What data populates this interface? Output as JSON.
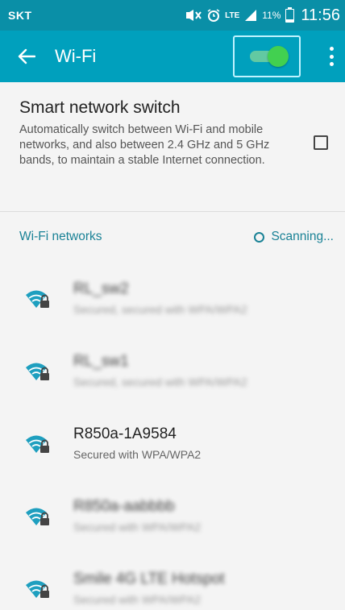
{
  "status_bar": {
    "carrier": "SKT",
    "network_type": "LTE",
    "battery_percent": "11%",
    "time": "11:56"
  },
  "app_bar": {
    "title": "Wi-Fi",
    "wifi_toggle_on": true
  },
  "smart_network_switch": {
    "title": "Smart network switch",
    "description": "Automatically switch between Wi-Fi and mobile networks, and also between 2.4 GHz and 5 GHz bands, to maintain a stable Internet connection.",
    "checked": false
  },
  "networks_section": {
    "label": "Wi-Fi networks",
    "status": "Scanning..."
  },
  "networks": [
    {
      "name": "RL_sw2",
      "security": "Secured, secured with WPA/WPA2",
      "blurred": true
    },
    {
      "name": "RL_sw1",
      "security": "Secured, secured with WPA/WPA2",
      "blurred": true
    },
    {
      "name": "R850a-1A9584",
      "security": "Secured with WPA/WPA2",
      "blurred": false
    },
    {
      "name": "R850a-aabbbb",
      "security": "Secured with WPA/WPA2",
      "blurred": true
    },
    {
      "name": "Smile 4G LTE Hotspot",
      "security": "Secured with WPA/WPA2",
      "blurred": true
    }
  ],
  "colors": {
    "status_bar": "#0a8fa7",
    "app_bar": "#00a0bd",
    "accent": "#1a8296",
    "toggle_on": "#42d050"
  }
}
